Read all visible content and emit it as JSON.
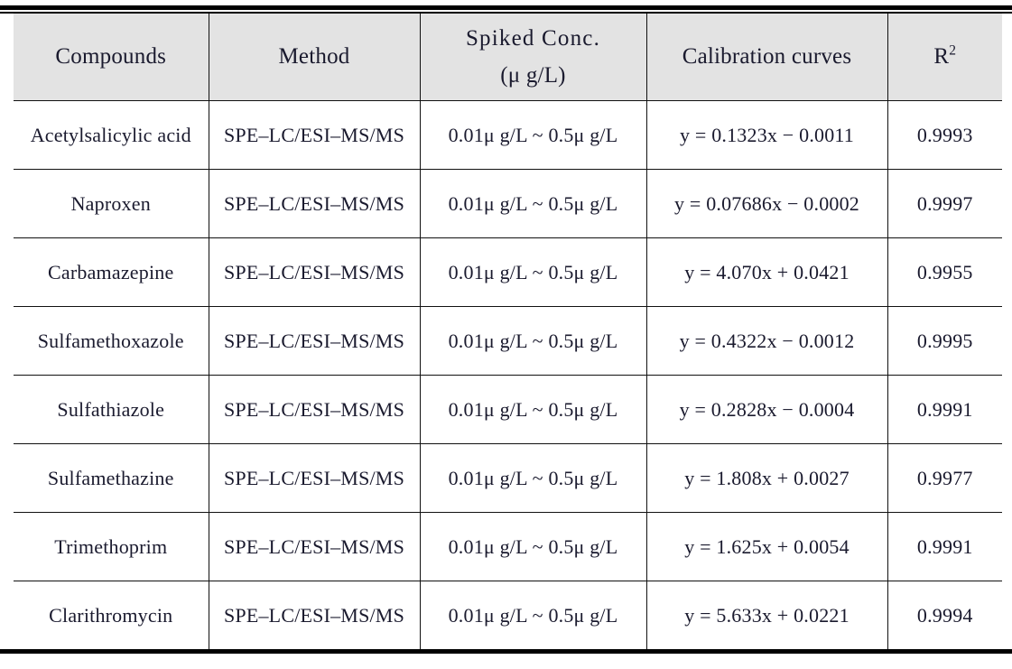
{
  "table": {
    "columns": [
      {
        "key": "compound",
        "label": "Compounds"
      },
      {
        "key": "method",
        "label": "Method"
      },
      {
        "key": "spiked_line1",
        "label": "Spiked Conc.",
        "label_line2": "(μ g/L)"
      },
      {
        "key": "calibration",
        "label": "Calibration curves"
      },
      {
        "key": "r2",
        "label": "R",
        "label_sup": "2"
      }
    ],
    "headers": {
      "compounds": "Compounds",
      "method": "Method",
      "spiked_conc_line1": "Spiked Conc.",
      "spiked_conc_line2": "(μ g/L)",
      "calibration_curves": "Calibration curves",
      "r_squared_base": "R",
      "r_squared_exponent": "2"
    },
    "rows": [
      {
        "compound": "Acetylsalicylic acid",
        "method": "SPE–LC/ESI–MS/MS",
        "spiked": "0.01μ g/L ~ 0.5μ g/L",
        "calibration": "y = 0.1323x − 0.0011",
        "r2": "0.9993"
      },
      {
        "compound": "Naproxen",
        "method": "SPE–LC/ESI–MS/MS",
        "spiked": "0.01μ g/L ~ 0.5μ g/L",
        "calibration": "y = 0.07686x − 0.0002",
        "r2": "0.9997"
      },
      {
        "compound": "Carbamazepine",
        "method": "SPE–LC/ESI–MS/MS",
        "spiked": "0.01μ g/L ~ 0.5μ g/L",
        "calibration": "y = 4.070x + 0.0421",
        "r2": "0.9955"
      },
      {
        "compound": "Sulfamethoxazole",
        "method": "SPE–LC/ESI–MS/MS",
        "spiked": "0.01μ g/L ~ 0.5μ g/L",
        "calibration": "y = 0.4322x − 0.0012",
        "r2": "0.9995"
      },
      {
        "compound": "Sulfathiazole",
        "method": "SPE–LC/ESI–MS/MS",
        "spiked": "0.01μ g/L ~ 0.5μ g/L",
        "calibration": "y = 0.2828x − 0.0004",
        "r2": "0.9991"
      },
      {
        "compound": "Sulfamethazine",
        "method": "SPE–LC/ESI–MS/MS",
        "spiked": "0.01μ g/L ~ 0.5μ g/L",
        "calibration": "y = 1.808x + 0.0027",
        "r2": "0.9977"
      },
      {
        "compound": "Trimethoprim",
        "method": "SPE–LC/ESI–MS/MS",
        "spiked": "0.01μ g/L ~ 0.5μ g/L",
        "calibration": "y = 1.625x + 0.0054",
        "r2": "0.9991"
      },
      {
        "compound": "Clarithromycin",
        "method": "SPE–LC/ESI–MS/MS",
        "spiked": "0.01μ g/L ~ 0.5μ g/L",
        "calibration": "y = 5.633x + 0.0221",
        "r2": "0.9994"
      }
    ]
  },
  "style": {
    "header_background": "#e3e3e3",
    "rule_color": "#000000",
    "text_color": "#1a1a2e"
  }
}
